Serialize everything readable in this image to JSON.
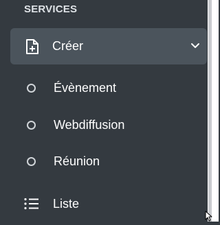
{
  "sidebar": {
    "section_header": "SERVICES",
    "parent": {
      "label": "Créer",
      "icon": "file-plus-icon",
      "expanded": true
    },
    "sub_items": [
      {
        "label": "Évènement",
        "icon": "circle-icon"
      },
      {
        "label": "Webdiffusion",
        "icon": "circle-icon"
      },
      {
        "label": "Réunion",
        "icon": "circle-icon"
      }
    ],
    "list_item": {
      "label": "Liste",
      "icon": "list-icon"
    }
  },
  "colors": {
    "sidebar_bg": "#343a40",
    "active_bg": "#4b545c",
    "text": "#ffffff",
    "header_text": "#dee2e6"
  }
}
